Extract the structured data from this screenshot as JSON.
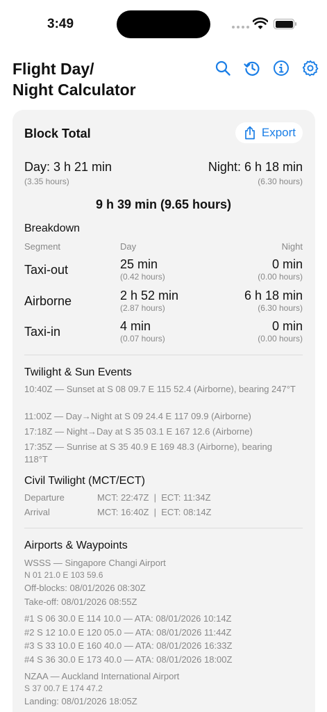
{
  "status_bar": {
    "time": "3:49"
  },
  "header": {
    "title": "Flight Day/\nNight Calculator"
  },
  "toolbar": {
    "icons": [
      "search-icon",
      "history-icon",
      "info-icon",
      "gear-icon"
    ],
    "accent": "#1a7ee6"
  },
  "block": {
    "title": "Block Total",
    "export_label": "Export",
    "day_label": "Day: 3 h 21 min",
    "day_hours": "(3.35 hours)",
    "night_label": "Night: 6 h 18 min",
    "night_hours": "(6.30 hours)",
    "total": "9 h 39 min (9.65 hours)"
  },
  "breakdown": {
    "title": "Breakdown",
    "headers": {
      "segment": "Segment",
      "day": "Day",
      "night": "Night"
    },
    "rows": [
      {
        "segment": "Taxi-out",
        "day": "25 min",
        "day_hours": "(0.42 hours)",
        "night": "0 min",
        "night_hours": "(0.00 hours)"
      },
      {
        "segment": "Airborne",
        "day": "2 h 52 min",
        "day_hours": "(2.87 hours)",
        "night": "6 h 18 min",
        "night_hours": "(6.30 hours)"
      },
      {
        "segment": "Taxi-in",
        "day": "4 min",
        "day_hours": "(0.07 hours)",
        "night": "0 min",
        "night_hours": "(0.00 hours)"
      }
    ]
  },
  "twilight_events": {
    "title": "Twilight & Sun Events",
    "events": [
      "10:40Z — Sunset at S 08 09.7 E 115 52.4 (Airborne), bearing 247°T",
      "11:00Z — Day→Night at S 09 24.4 E 117 09.9 (Airborne)",
      "17:18Z — Night→Day at S 35 03.1 E 167 12.6 (Airborne)",
      "17:35Z — Sunrise at S 35 40.9 E 169 48.3 (Airborne), bearing 118°T"
    ]
  },
  "civil_twilight": {
    "title": "Civil Twilight (MCT/ECT)",
    "rows": [
      {
        "label": "Departure",
        "value": "MCT: 22:47Z  |  ECT: 11:34Z"
      },
      {
        "label": "Arrival",
        "value": "MCT: 16:40Z  |  ECT: 08:14Z"
      }
    ]
  },
  "airports": {
    "title": "Airports & Waypoints",
    "departure": {
      "name": "WSSS — Singapore Changi Airport",
      "coords": "N 01 21.0 E 103 59.6",
      "off_blocks": "Off-blocks: 08/01/2026 08:30Z",
      "takeoff": "Take-off: 08/01/2026 08:55Z"
    },
    "waypoints": [
      "#1 S 06 30.0 E 114 10.0 — ATA: 08/01/2026 10:14Z",
      "#2 S 12 10.0 E 120 05.0 — ATA: 08/01/2026 11:44Z",
      "#3 S 33 10.0 E 160 40.0 — ATA: 08/01/2026 16:33Z",
      "#4 S 36 30.0 E 173 40.0 — ATA: 08/01/2026 18:00Z"
    ],
    "arrival": {
      "name": "NZAA — Auckland International Airport",
      "coords": "S 37 00.7 E 174 47.2",
      "landing": "Landing: 08/01/2026 18:05Z"
    }
  }
}
